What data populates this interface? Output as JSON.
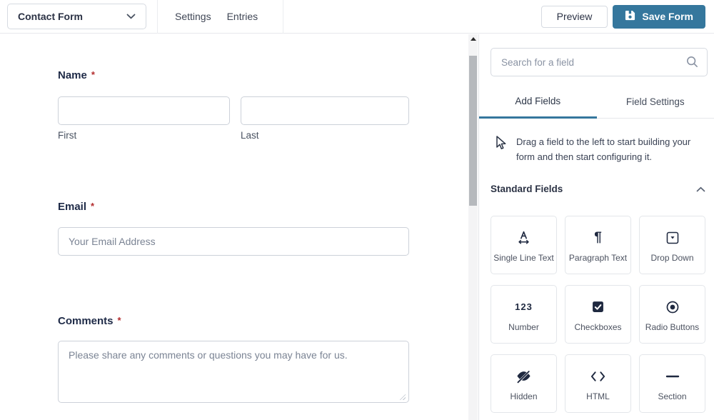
{
  "topbar": {
    "form_selector": {
      "label": "Contact Form"
    },
    "nav_tabs": [
      {
        "label": "Settings"
      },
      {
        "label": "Entries"
      }
    ],
    "preview_label": "Preview",
    "save_label": "Save Form"
  },
  "canvas": {
    "fields": {
      "name": {
        "label": "Name",
        "required": "*",
        "sublabels": {
          "first": "First",
          "last": "Last"
        }
      },
      "email": {
        "label": "Email",
        "required": "*",
        "placeholder": "Your Email Address"
      },
      "comments": {
        "label": "Comments",
        "required": "*",
        "placeholder": "Please share any comments or questions you may have for us."
      }
    }
  },
  "sidebar": {
    "search": {
      "placeholder": "Search for a field"
    },
    "tabs": {
      "add_fields": "Add Fields",
      "field_settings": "Field Settings"
    },
    "drag_hint": "Drag a field to the left to start building your form and then start configuring it.",
    "section_title": "Standard Fields",
    "fields": [
      {
        "label": "Single Line Text",
        "icon": "single-line-text"
      },
      {
        "label": "Paragraph Text",
        "icon": "paragraph-text"
      },
      {
        "label": "Drop Down",
        "icon": "drop-down"
      },
      {
        "label": "Number",
        "icon": "number"
      },
      {
        "label": "Checkboxes",
        "icon": "checkboxes"
      },
      {
        "label": "Radio Buttons",
        "icon": "radio-buttons"
      },
      {
        "label": "Hidden",
        "icon": "hidden"
      },
      {
        "label": "HTML",
        "icon": "html"
      },
      {
        "label": "Section",
        "icon": "section"
      }
    ]
  },
  "colors": {
    "accent_blue": "#35779d",
    "icon_navy": "#1f2940",
    "required_red": "#b32d2e"
  }
}
